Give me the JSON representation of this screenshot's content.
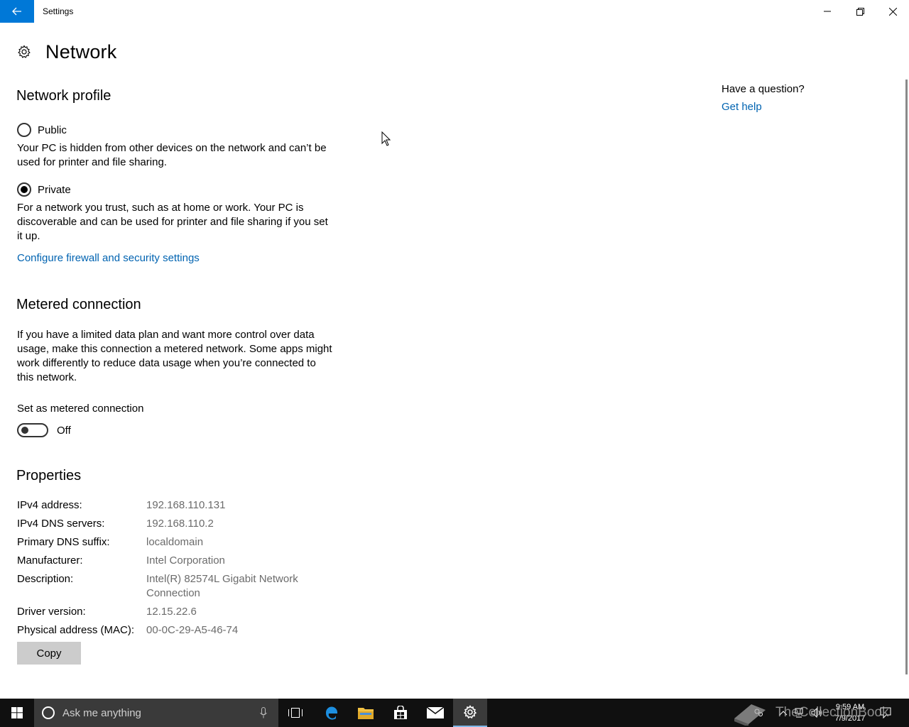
{
  "window": {
    "title": "Settings",
    "minimize_icon": "minimize-icon",
    "restore_icon": "restore-icon",
    "close_icon": "close-icon"
  },
  "header": {
    "title": "Network",
    "icon": "gear-icon"
  },
  "network_profile": {
    "heading": "Network profile",
    "options": [
      {
        "label": "Public",
        "selected": false,
        "description": "Your PC is hidden from other devices on the network and can’t be used for printer and file sharing."
      },
      {
        "label": "Private",
        "selected": true,
        "description": "For a network you trust, such as at home or work. Your PC is discoverable and can be used for printer and file sharing if you set it up."
      }
    ],
    "firewall_link": "Configure firewall and security settings"
  },
  "metered": {
    "heading": "Metered connection",
    "description": "If you have a limited data plan and want more control over data usage, make this connection a metered network. Some apps might work differently to reduce data usage when you’re connected to this network.",
    "toggle_label": "Set as metered connection",
    "toggle_state": "Off",
    "toggle_on": false
  },
  "properties": {
    "heading": "Properties",
    "rows": [
      {
        "key": "IPv4 address:",
        "value": "192.168.110.131"
      },
      {
        "key": "IPv4 DNS servers:",
        "value": "192.168.110.2"
      },
      {
        "key": "Primary DNS suffix:",
        "value": "localdomain"
      },
      {
        "key": "Manufacturer:",
        "value": "Intel Corporation"
      },
      {
        "key": "Description:",
        "value": "Intel(R) 82574L Gigabit Network Connection"
      },
      {
        "key": "Driver version:",
        "value": "12.15.22.6"
      },
      {
        "key": "Physical address (MAC):",
        "value": "00-0C-29-A5-46-74"
      }
    ],
    "copy_label": "Copy"
  },
  "aside": {
    "question": "Have a question?",
    "help_link": "Get help"
  },
  "taskbar": {
    "search_placeholder": "Ask me anything",
    "time": "9:59 AM",
    "date": "7/9/2017",
    "icons": [
      "start-icon",
      "microphone-icon",
      "task-view-icon",
      "edge-icon",
      "file-explorer-icon",
      "store-icon",
      "mail-icon",
      "settings-icon"
    ]
  },
  "watermark": "TheCollectionBook",
  "colors": {
    "accent": "#0078d7",
    "link": "#0063b1",
    "taskbar": "#101010",
    "secondary_text": "#6b6b6b"
  }
}
